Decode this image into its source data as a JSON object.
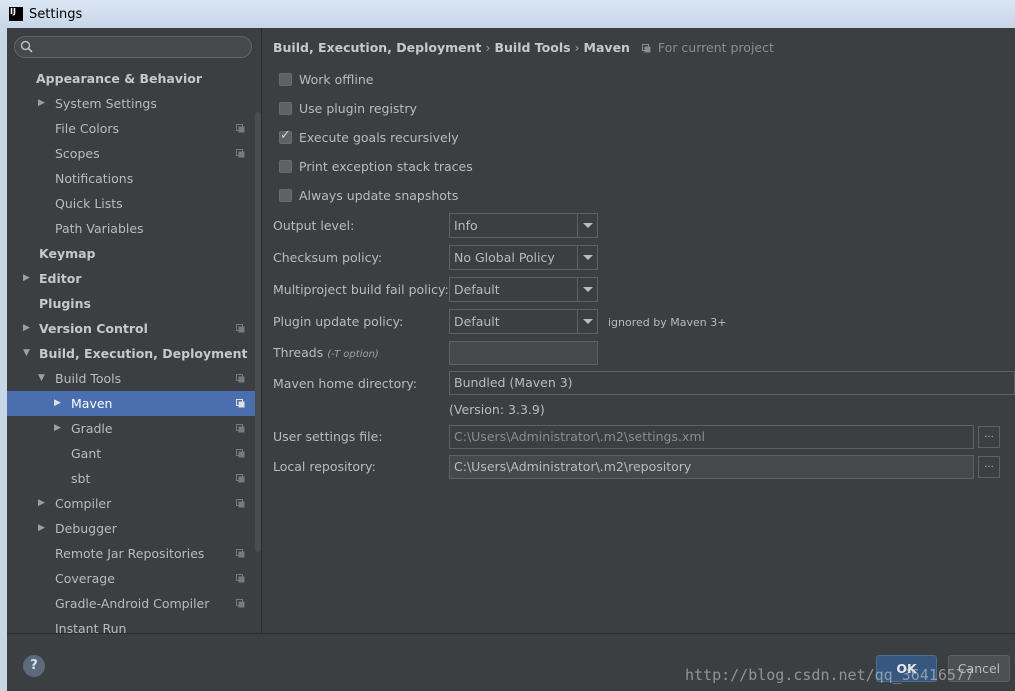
{
  "window": {
    "title": "Settings"
  },
  "search": {
    "placeholder": ""
  },
  "sidebar": {
    "items": [
      {
        "label": "Appearance & Behavior",
        "level": 0,
        "bold": true,
        "arrow": "none",
        "project": false
      },
      {
        "label": "System Settings",
        "level": 1,
        "bold": false,
        "arrow": "right",
        "project": false
      },
      {
        "label": "File Colors",
        "level": 1,
        "bold": false,
        "arrow": "none",
        "project": true
      },
      {
        "label": "Scopes",
        "level": 1,
        "bold": false,
        "arrow": "none",
        "project": true
      },
      {
        "label": "Notifications",
        "level": 1,
        "bold": false,
        "arrow": "none",
        "project": false
      },
      {
        "label": "Quick Lists",
        "level": 1,
        "bold": false,
        "arrow": "none",
        "project": false
      },
      {
        "label": "Path Variables",
        "level": 1,
        "bold": false,
        "arrow": "none",
        "project": false
      },
      {
        "label": "Keymap",
        "level": 0,
        "bold": true,
        "arrow": "none",
        "project": false
      },
      {
        "label": "Editor",
        "level": 0,
        "bold": true,
        "arrow": "right",
        "project": false
      },
      {
        "label": "Plugins",
        "level": 0,
        "bold": true,
        "arrow": "none",
        "project": false
      },
      {
        "label": "Version Control",
        "level": 0,
        "bold": true,
        "arrow": "right",
        "project": true
      },
      {
        "label": "Build, Execution, Deployment",
        "level": 0,
        "bold": true,
        "arrow": "down",
        "project": false
      },
      {
        "label": "Build Tools",
        "level": 1,
        "bold": false,
        "arrow": "down",
        "project": true
      },
      {
        "label": "Maven",
        "level": 2,
        "bold": false,
        "arrow": "right",
        "project": true,
        "selected": true
      },
      {
        "label": "Gradle",
        "level": 2,
        "bold": false,
        "arrow": "right",
        "project": true
      },
      {
        "label": "Gant",
        "level": 2,
        "bold": false,
        "arrow": "none",
        "project": true
      },
      {
        "label": "sbt",
        "level": 2,
        "bold": false,
        "arrow": "none",
        "project": true
      },
      {
        "label": "Compiler",
        "level": 1,
        "bold": false,
        "arrow": "right",
        "project": true
      },
      {
        "label": "Debugger",
        "level": 1,
        "bold": false,
        "arrow": "right",
        "project": false
      },
      {
        "label": "Remote Jar Repositories",
        "level": 1,
        "bold": false,
        "arrow": "none",
        "project": true
      },
      {
        "label": "Coverage",
        "level": 1,
        "bold": false,
        "arrow": "none",
        "project": true
      },
      {
        "label": "Gradle-Android Compiler",
        "level": 1,
        "bold": false,
        "arrow": "none",
        "project": true
      },
      {
        "label": "Instant Run",
        "level": 1,
        "bold": false,
        "arrow": "none",
        "project": false
      }
    ]
  },
  "breadcrumb": {
    "items": [
      "Build, Execution, Deployment",
      "Build Tools",
      "Maven"
    ],
    "separator": "›",
    "scope_note": "For current project"
  },
  "options": {
    "work_offline": {
      "label": "Work offline",
      "checked": false
    },
    "use_plugin_registry": {
      "label": "Use plugin registry",
      "checked": false
    },
    "execute_goals_recursively": {
      "label": "Execute goals recursively",
      "checked": true
    },
    "print_exception_stack_traces": {
      "label": "Print exception stack traces",
      "checked": false
    },
    "always_update_snapshots": {
      "label": "Always update snapshots",
      "checked": false
    }
  },
  "fields": {
    "output_level": {
      "label": "Output level:",
      "value": "Info"
    },
    "checksum_policy": {
      "label": "Checksum policy:",
      "value": "No Global Policy"
    },
    "multiproject_fail_policy": {
      "label": "Multiproject build fail policy:",
      "value": "Default"
    },
    "plugin_update_policy": {
      "label": "Plugin update policy:",
      "value": "Default",
      "note": "ignored by Maven 3+"
    },
    "threads": {
      "label": "Threads",
      "hint": "(-T option)",
      "value": ""
    },
    "maven_home": {
      "label": "Maven home directory:",
      "value": "Bundled (Maven 3)",
      "version": "(Version: 3.3.9)"
    },
    "user_settings_file": {
      "label": "User settings file:",
      "value": "C:\\Users\\Administrator\\.m2\\settings.xml",
      "browse": "..."
    },
    "local_repository": {
      "label": "Local repository:",
      "value": "C:\\Users\\Administrator\\.m2\\repository",
      "browse": "..."
    }
  },
  "footer": {
    "help": "?",
    "ok": "OK",
    "cancel": "Cancel",
    "watermark": "http://blog.csdn.net/qq_36416577"
  },
  "colors": {
    "background": "#3c3f41",
    "selection": "#4b6eaf",
    "ok_button": "#365880"
  }
}
